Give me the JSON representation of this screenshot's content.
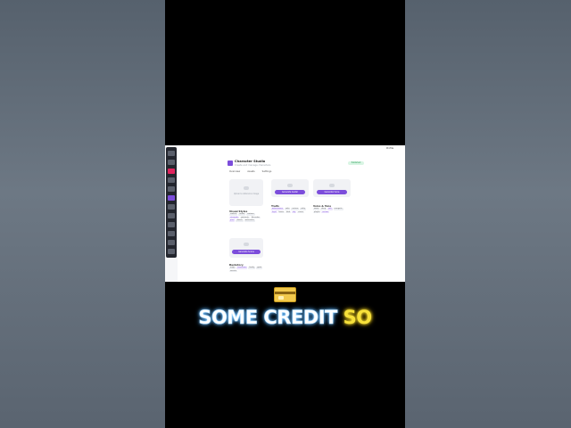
{
  "app": {
    "title": "Character Studio",
    "subtitle": "Create and manage characters",
    "status": "Published",
    "user_label": "Profile",
    "toolbar": [
      "Overview",
      "Assets",
      "Settings"
    ],
    "rail_items": [
      "home",
      "chat",
      "characters",
      "explore",
      "create",
      "images",
      "voice",
      "video",
      "library",
      "settings",
      "help",
      "logout"
    ],
    "cards": [
      {
        "hint": "Upload a reference image",
        "button": null
      },
      {
        "hint": "",
        "button": "Generate Avatar"
      },
      {
        "hint": "",
        "button": "Generate Voice"
      },
      {
        "hint": "",
        "button": "Generate Scene"
      }
    ],
    "sections": {
      "visual_styles": {
        "title": "Visual Styles",
        "tags": [
          "realistic",
          "anime",
          "cartoon",
          "cinematic",
          "painterly",
          "3d render",
          "pixel",
          "sketch",
          "watercolor"
        ]
      },
      "traits": {
        "title": "Traits",
        "tags": [
          "adventurous",
          "calm",
          "curious",
          "witty",
          "loyal",
          "brave",
          "kind",
          "shy",
          "clever"
        ]
      },
      "voice": {
        "title": "Voice & Tone",
        "tags": [
          "warm",
          "deep",
          "soft",
          "energetic",
          "playful",
          "serious"
        ]
      },
      "backstory": {
        "title": "Backstory",
        "tags": [
          "origin",
          "hometown",
          "family",
          "goals",
          "secrets"
        ]
      }
    }
  },
  "overlay": {
    "emoji": "credit-card",
    "caption_white": "SOME CREDIT",
    "caption_yellow": "SO"
  },
  "colors": {
    "accent": "#7c4ddb",
    "rail_active": "#e0245e",
    "caption_yellow": "#f7e13a"
  }
}
